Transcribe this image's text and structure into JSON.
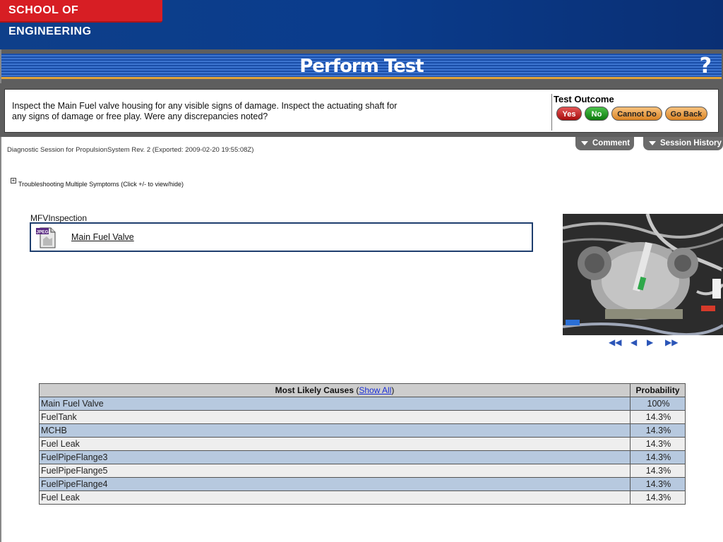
{
  "header": {
    "school_label": "SCHOOL OF ENGINEERING",
    "page_title": "Perform Test",
    "help_label": "?"
  },
  "instruction": {
    "line1": "Inspect the Main Fuel valve housing for any visible signs of damage. Inspect the actuating shaft for",
    "line2": "any signs of damage or free play. Were any discrepancies noted?"
  },
  "test_outcome": {
    "title": "Test Outcome",
    "yes_label": "Yes",
    "no_label": "No",
    "cannot_do_label": "Cannot Do",
    "go_back_label": "Go Back"
  },
  "tabs": {
    "comment_label": "Comment",
    "session_history_label": "Session History"
  },
  "session_info": "Diagnostic Session for PropulsionSystem Rev. 2 (Exported: 2009-02-20 19:55:08Z)",
  "troubleshooting": {
    "toggle_symbol": "+",
    "label": "Troubleshooting Multiple Symptoms (Click +/- to view/hide)"
  },
  "test": {
    "name": "MFVInspection",
    "attachment_icon_label": "JPEG",
    "attachment_label": "Main Fuel Valve"
  },
  "image_nav": {
    "first": "◀◀",
    "prev": "◀",
    "next": "▶",
    "last": "▶▶"
  },
  "causes_table": {
    "header_label": "Most Likely Causes",
    "open_paren": "(",
    "show_all_label": "Show All",
    "close_paren": ")",
    "probability_header": "Probability",
    "rows": [
      {
        "cause": "Main Fuel Valve",
        "probability": "100%"
      },
      {
        "cause": "FuelTank",
        "probability": "14.3%"
      },
      {
        "cause": "MCHB",
        "probability": "14.3%"
      },
      {
        "cause": "Fuel Leak",
        "probability": "14.3%"
      },
      {
        "cause": "FuelPipeFlange3",
        "probability": "14.3%"
      },
      {
        "cause": "FuelPipeFlange5",
        "probability": "14.3%"
      },
      {
        "cause": "FuelPipeFlange4",
        "probability": "14.3%"
      },
      {
        "cause": "Fuel Leak",
        "probability": "14.3%"
      }
    ]
  },
  "colors": {
    "header_blue": "#0a3c8c",
    "school_red": "#d71e24",
    "accent_orange": "#e0a338",
    "row_blue": "#b7c9df"
  }
}
